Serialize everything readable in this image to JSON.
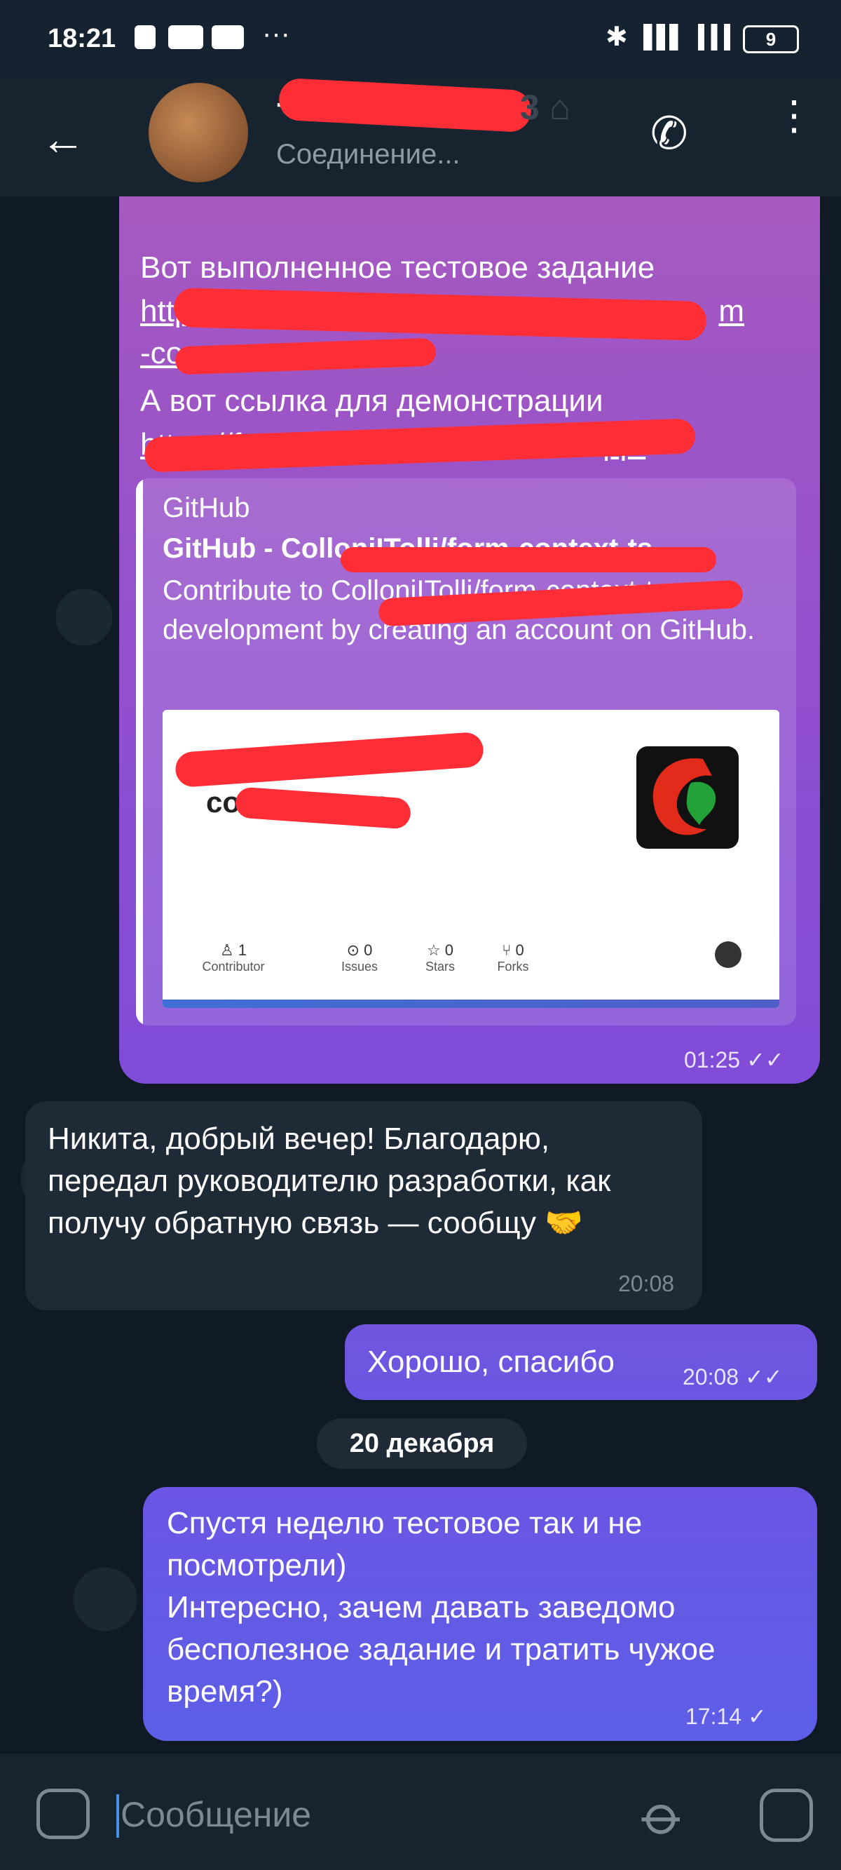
{
  "status_bar": {
    "time": "18:21",
    "battery": "9",
    "icons": [
      "notification-icon",
      "wb-icon",
      "youtube-icon",
      "more-dots-icon",
      "bluetooth-icon",
      "signal-4g-icon",
      "signal-icon",
      "battery-icon"
    ]
  },
  "header": {
    "title_visible_fragment": "+",
    "subtitle": "Соединение...",
    "icons": [
      "back-arrow-icon",
      "phone-icon",
      "more-vert-icon"
    ]
  },
  "messages": {
    "m1": {
      "line1": "Вот выполненное тестовое задание",
      "link1_start": "https",
      "link1_end": "m",
      "link1_line2_start": "-co",
      "line3": "А вот ссылка для демонстрации",
      "link2_start": "https://form",
      "link2_end": "pp/",
      "time": "01:25",
      "preview": {
        "site": "GitHub",
        "title": "GitHub - ColloniITolli/form-context-ts",
        "description": "Contribute to ColloniITolli/form-context-ts development by creating an account on GitHub.",
        "card": {
          "repo_name_line1": "C",
          "repo_name_line2": "co",
          "repo_name_line2_end": "s",
          "stats": [
            {
              "value": "1",
              "label": "Contributor"
            },
            {
              "value": "0",
              "label": "Issues"
            },
            {
              "value": "0",
              "label": "Stars"
            },
            {
              "value": "0",
              "label": "Forks"
            }
          ]
        }
      }
    },
    "m2": {
      "text": "Никита, добрый вечер! Благодарю, передал руководителю разработки, как получу обратную связь — сообщу 🤝",
      "time": "20:08"
    },
    "m3": {
      "text": "Хорошо, спасибо",
      "time": "20:08"
    },
    "date_separator": "20 декабря",
    "m4": {
      "text": "Спустя неделю тестовое так и не посмотрели)\nИнтересно, зачем давать заведомо бесполезное задание и тратить чужое время?)",
      "time": "17:14"
    }
  },
  "composer": {
    "placeholder": "Сообщение",
    "icons": [
      "sticker-icon",
      "attach-icon",
      "camera-icon"
    ]
  },
  "colors": {
    "chat_bg": "#0f1a24",
    "redaction": "#ff2e36",
    "outgoing_accent": "#7f4cd8",
    "incoming_bubble": "#1e2a36"
  }
}
